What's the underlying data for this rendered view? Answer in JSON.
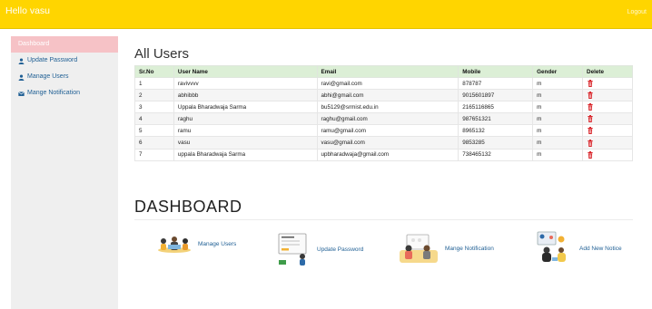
{
  "topbar": {
    "greeting": "Hello vasu",
    "logout": "Logout"
  },
  "sidebar": {
    "items": [
      {
        "label": "Dashboard",
        "icon": "none",
        "active": true
      },
      {
        "label": "Update Password",
        "icon": "user-icon"
      },
      {
        "label": "Manage Users",
        "icon": "user-icon"
      },
      {
        "label": "Mange Notification",
        "icon": "envelope-icon"
      }
    ]
  },
  "users": {
    "title": "All Users",
    "headers": [
      "Sr.No",
      "User Name",
      "Email",
      "Mobile",
      "Gender",
      "Delete"
    ],
    "rows": [
      {
        "sr": "1",
        "name": "ravivvvv",
        "email": "ravi@gmail.com",
        "mobile": "878787",
        "gender": "m"
      },
      {
        "sr": "2",
        "name": "abhibbb",
        "email": "abhi@gmail.com",
        "mobile": "9015601897",
        "gender": "m"
      },
      {
        "sr": "3",
        "name": "Uppala Bharadwaja Sarma",
        "email": "bu5129@srmist.edu.in",
        "mobile": "2165116865",
        "gender": "m"
      },
      {
        "sr": "4",
        "name": "raghu",
        "email": "raghu@gmail.com",
        "mobile": "987651321",
        "gender": "m"
      },
      {
        "sr": "5",
        "name": "ramu",
        "email": "ramu@gmail.com",
        "mobile": "8965132",
        "gender": "m"
      },
      {
        "sr": "6",
        "name": "vasu",
        "email": "vasu@gmail.com",
        "mobile": "9853285",
        "gender": "m"
      },
      {
        "sr": "7",
        "name": "uppala Bharadwaja Sarma",
        "email": "upbharadwaja@gmail.com",
        "mobile": "738465132",
        "gender": "m"
      }
    ]
  },
  "dashboard": {
    "title": "DASHBOARD",
    "cards": [
      {
        "label": "Manage Users"
      },
      {
        "label": "Update Password"
      },
      {
        "label": "Mange Notification"
      },
      {
        "label": "Add New Notice"
      }
    ]
  },
  "colors": {
    "topbar": "#ffd500",
    "active_side": "#f6c2c6",
    "table_header": "#dcefd6",
    "delete": "#d9262b",
    "link": "#1f5f94"
  }
}
